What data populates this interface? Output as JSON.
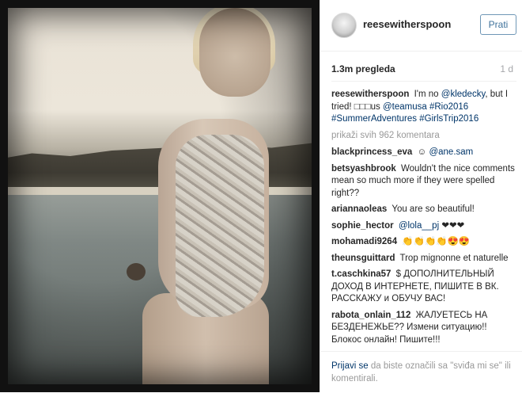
{
  "post": {
    "username": "reesewitherspoon",
    "follow_label": "Prati",
    "views": "1.3m pregleda",
    "age": "1 d"
  },
  "caption": {
    "user": "reesewitherspoon",
    "text_1": " I'm no ",
    "mention_1": "@kledecky",
    "text_2": ", but I tried! ",
    "emoji": "□□□",
    "text_3": "us ",
    "mention_2": "@teamusa",
    "tag_1": " #Rio2016",
    "tag_2": "#SummerAdventures",
    "tag_3": " #GirlsTrip2016"
  },
  "show_all": "prikaži svih 962 komentara",
  "comments": [
    {
      "user": "blackprincess_eva",
      "text": "☺",
      "link": "@ane.sam"
    },
    {
      "user": "betsyashbrook",
      "text": "Wouldn't the nice comments mean so much more if they were spelled right??",
      "link": ""
    },
    {
      "user": "ariannaoleas",
      "text": "You are so beautiful!",
      "link": ""
    },
    {
      "user": "sophie_hector",
      "text": "❤❤❤",
      "link": "@lola__pj"
    },
    {
      "user": "mohamadi9264",
      "text": "👏👏👏👏😍😍",
      "link": ""
    },
    {
      "user": "theunsguittard",
      "text": "Trop mignonne et naturelle",
      "link": ""
    },
    {
      "user": "t.caschkina57",
      "text": "$ ДОПОЛНИТЕЛЬНЫЙ ДОХОД В ИНТЕРНЕТЕ, ПИШИТЕ В ВК. РАССКАЖУ и ОБУЧУ ВАС!",
      "link": ""
    },
    {
      "user": "rabota_onlain_112",
      "text": "ЖАЛУЕТЕСЬ НА БЕЗДЕНЕЖЬЕ?? Измени ситуацию!! Блокос онлайн! Пишите!!!",
      "link": ""
    }
  ],
  "footer": {
    "login": "Prijavi se",
    "text": " da biste označili sa \"sviđa mi se\" ili komentirali."
  }
}
